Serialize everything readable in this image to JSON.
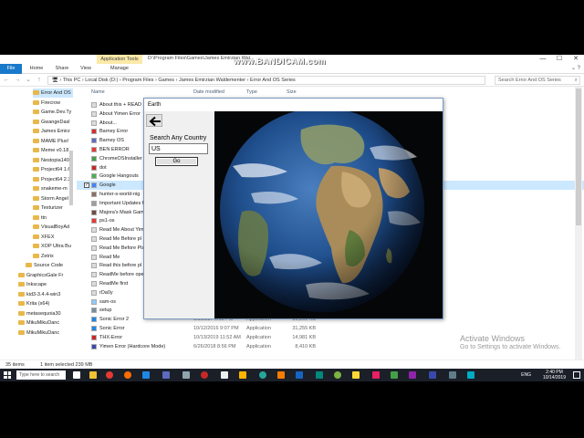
{
  "watermark": "www.BANDICAM.com",
  "explorer": {
    "context_tab": "Application Tools",
    "title_path": "D:\\Program Files\\Games\\James Emirzian Wal...",
    "ribbon_tabs": [
      "File",
      "Home",
      "Share",
      "View",
      "Manage"
    ],
    "address_parts": [
      "This PC",
      "Local Disk (D:)",
      "Program Files",
      "Games",
      "James Emirzian Waldementer",
      "Error And OS Series"
    ],
    "search_placeholder": "Search Error And OS Series",
    "columns": [
      "Name",
      "Date modified",
      "Type",
      "Size"
    ],
    "nav_items": [
      "Error And OS",
      "Firecrow",
      "Game.Dev.Ty",
      "GwangeDasl",
      "James Emirz",
      "MAME Plus!",
      "Meme v0.18",
      "Nestopia140",
      "Project64 1.6",
      "Project64 2.3",
      "snakeme-m",
      "Storm Angel",
      "Texturizer",
      "ttn",
      "VisualBoyAd",
      "XFEX",
      "XOP Ultra Bu",
      "Zetrix",
      "Source Code",
      "GraphicsGale Fr",
      "Inkscape",
      "kid3-3.4.4-win3",
      "Krita (x64)",
      "metasequoia30",
      "MikuMikuDanc",
      "MikuMikuDanc"
    ],
    "files": [
      {
        "name": "About this + READ",
        "date": "",
        "type": "",
        "size": ""
      },
      {
        "name": "About Yimen Error",
        "date": "",
        "type": "",
        "size": ""
      },
      {
        "name": "About...",
        "date": "",
        "type": "",
        "size": ""
      },
      {
        "name": "Barney Error",
        "date": "",
        "type": "",
        "size": ""
      },
      {
        "name": "Barney OS",
        "date": "",
        "type": "",
        "size": ""
      },
      {
        "name": "BEN ERROR",
        "date": "",
        "type": "",
        "size": ""
      },
      {
        "name": "ChromeOSInstaller",
        "date": "",
        "type": "",
        "size": ""
      },
      {
        "name": "dot",
        "date": "",
        "type": "",
        "size": ""
      },
      {
        "name": "Google Hangouts",
        "date": "",
        "type": "",
        "size": ""
      },
      {
        "name": "Google",
        "date": "",
        "type": "",
        "size": ""
      },
      {
        "name": "hunter-s-world-nig",
        "date": "",
        "type": "",
        "size": ""
      },
      {
        "name": "Important Updates fo",
        "date": "",
        "type": "",
        "size": ""
      },
      {
        "name": "Majora's Mask Gam",
        "date": "",
        "type": "",
        "size": ""
      },
      {
        "name": "ps1-os",
        "date": "",
        "type": "",
        "size": ""
      },
      {
        "name": "Read Me About Yim",
        "date": "",
        "type": "",
        "size": ""
      },
      {
        "name": "Read Me Before pl",
        "date": "",
        "type": "",
        "size": ""
      },
      {
        "name": "Read Me Before Pla",
        "date": "",
        "type": "",
        "size": ""
      },
      {
        "name": "Read Me",
        "date": "",
        "type": "",
        "size": ""
      },
      {
        "name": "Read this before pl",
        "date": "",
        "type": "",
        "size": ""
      },
      {
        "name": "ReadMe before ope",
        "date": "",
        "type": "",
        "size": ""
      },
      {
        "name": "ReadMe first",
        "date": "",
        "type": "",
        "size": ""
      },
      {
        "name": "rDa0y",
        "date": "",
        "type": "",
        "size": ""
      },
      {
        "name": "sam-os",
        "date": "",
        "type": "",
        "size": ""
      },
      {
        "name": "setup",
        "date": "",
        "type": "",
        "size": ""
      },
      {
        "name": "Sonic Error 2",
        "date": "6/9/2017 6:52 PM",
        "type": "Application",
        "size": "31,365 KB"
      },
      {
        "name": "Sonic Error",
        "date": "10/12/2016 9:07 PM",
        "type": "Application",
        "size": "31,255 KB"
      },
      {
        "name": "THX-Error",
        "date": "10/13/2019 11:52 AM",
        "type": "Application",
        "size": "14,981 KB"
      },
      {
        "name": "Yimen Error (Hardcore Mode)",
        "date": "6/26/2018 8:56 PM",
        "type": "Application",
        "size": "8,410 KB"
      }
    ],
    "selected_file_index": 9,
    "status_items": "35 items",
    "status_selected": "1 item selected  239 MB"
  },
  "earth_app": {
    "title": "Earth",
    "search_label": "Search Any Country",
    "country_value": "US",
    "go_label": "Go"
  },
  "activate": {
    "line1": "Activate Windows",
    "line2": "Go to Settings to activate Windows."
  },
  "taskbar": {
    "search_placeholder": "Type here to search",
    "lang": "ENG",
    "time": "2:40 PM",
    "date": "10/14/2019"
  }
}
